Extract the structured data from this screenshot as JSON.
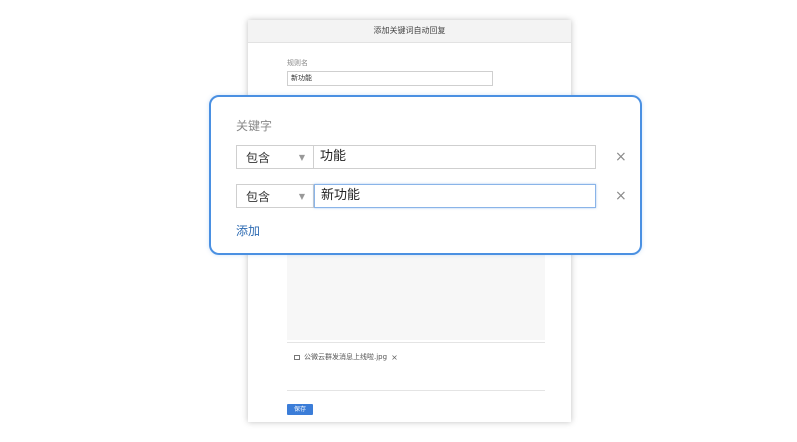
{
  "dialog": {
    "title": "添加关键词自动回复",
    "rule_name_label": "规则名",
    "rule_name_value": "新功能",
    "attachment_name": "公微云群发消息上线啦.jpg",
    "remove_attachment": "×",
    "save_label": "保存"
  },
  "keyword_panel": {
    "title": "关键字",
    "rows": [
      {
        "match_type": "包含",
        "keyword": "功能"
      },
      {
        "match_type": "包含",
        "keyword": "新功能"
      }
    ],
    "remove_symbol": "×",
    "add_label": "添加"
  },
  "icons": {
    "select_caret": "▼",
    "attachment": "image-icon"
  },
  "colors": {
    "accent": "#4a90e2",
    "link": "#2f6cb3",
    "save_button": "#3b7dd8"
  }
}
